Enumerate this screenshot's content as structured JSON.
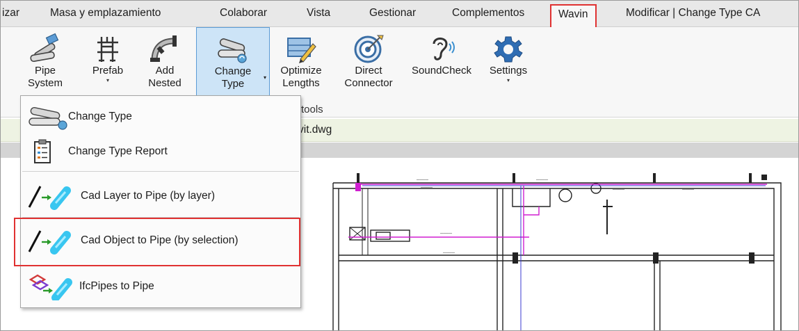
{
  "tabs": [
    {
      "label": "izar"
    },
    {
      "label": "Masa y emplazamiento"
    },
    {
      "label": "Colaborar"
    },
    {
      "label": "Vista"
    },
    {
      "label": "Gestionar"
    },
    {
      "label": "Complementos"
    },
    {
      "label": "Wavin",
      "active": true
    },
    {
      "label": "Modificar | Change Type CA"
    }
  ],
  "ribbon": {
    "buttons": [
      {
        "line1": "Pipe",
        "line2": "System",
        "icon": "pipe-system-icon"
      },
      {
        "line1": "Prefab",
        "line2": "▾",
        "icon": "prefab-icon"
      },
      {
        "line1": "Add",
        "line2": "Nested",
        "icon": "add-nested-icon"
      },
      {
        "line1": "Change",
        "line2": "Type",
        "icon": "change-type-icon"
      },
      {
        "line1": "Optimize",
        "line2": "Lengths",
        "icon": "optimize-lengths-icon"
      },
      {
        "line1": "Direct",
        "line2": "Connector",
        "icon": "direct-connector-icon"
      },
      {
        "line1": "SoundCheck",
        "line2": "",
        "icon": "soundcheck-icon"
      },
      {
        "line1": "Settings",
        "line2": "▾",
        "icon": "settings-gear-icon"
      }
    ],
    "change_type_caret": "▾",
    "panel_label": "tools"
  },
  "infostrip": {
    "filename": "vit.dwg"
  },
  "menu": {
    "items": [
      {
        "label": "Change Type",
        "icon": "change-type-icon"
      },
      {
        "label": "Change Type Report",
        "icon": "report-clipboard-icon"
      },
      {
        "label": "Cad Layer to Pipe (by layer)",
        "icon": "cad-to-pipe-icon"
      },
      {
        "label": "Cad Object to Pipe (by selection)",
        "icon": "cad-to-pipe-icon",
        "highlighted": true
      },
      {
        "label": "IfcPipes to Pipe",
        "icon": "ifc-to-pipe-icon"
      }
    ]
  },
  "colors": {
    "highlight_red": "#e03131",
    "selected_blue": "#cde4f7",
    "pipe_magenta": "#d01ed0",
    "pipe_cyan": "#38c6f0"
  }
}
